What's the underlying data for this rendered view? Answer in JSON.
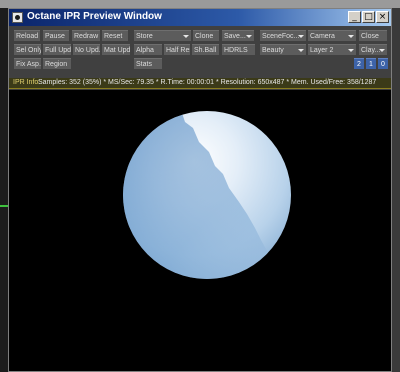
{
  "window": {
    "title": "Octane IPR Preview Window"
  },
  "title_buttons": {
    "minimize": "_",
    "maximize": "□",
    "close": "×"
  },
  "toolbar": {
    "row1": {
      "reload": "Reload",
      "pause": "Pause",
      "redraw": "Redraw",
      "reset": "Reset",
      "store": "Store",
      "clone": "Clone",
      "save": "Save...",
      "scene": "SceneFoc...",
      "camera": "Camera",
      "close": "Close"
    },
    "row2": {
      "sel_only": "Sel Only",
      "full_upd": "Full Upd.",
      "no_upd": "No Upd.",
      "mat_upd": "Mat Upd.",
      "alpha": "Alpha",
      "half_res": "Half Res",
      "sh_ball": "Sh.Ball",
      "hdrls": "HDRLS",
      "beauty": "Beauty",
      "layer": "Layer 2",
      "clay": "Clay..."
    },
    "row3": {
      "fix_asp": "Fix Asp.",
      "region": "Region",
      "stats": "Stats",
      "num2": "2",
      "num1": "1",
      "num0": "0"
    }
  },
  "info": {
    "label": "IPR Info:",
    "text": "Samples: 352 (35%)  *  MS/Sec: 79.35  *  R.Time: 00:00:01  *  Resolution: 650x487  *  Mem. Used/Free: 358/1287"
  },
  "colors": {
    "sphere_highlight": "#eef4fa",
    "sphere_shadow": "#3a78b8",
    "toolbar_button": "#5c5c5c",
    "active_button": "#3d63a8"
  }
}
